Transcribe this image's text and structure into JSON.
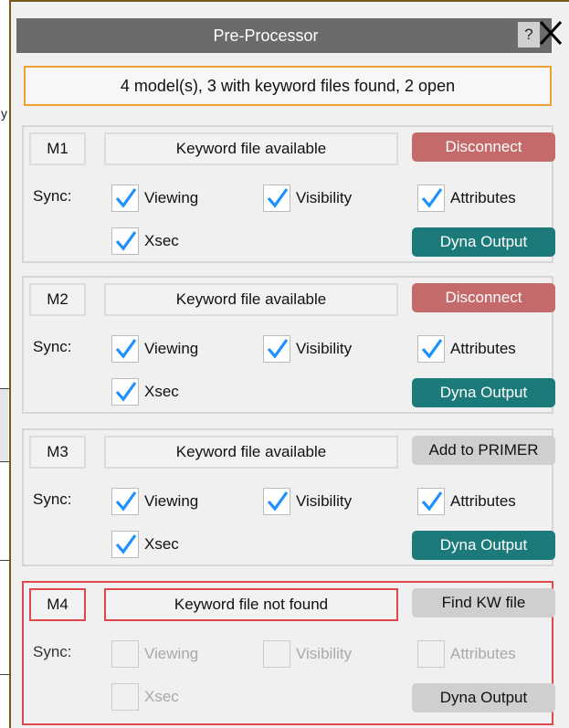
{
  "background_artifact_char": "y",
  "window": {
    "title": "Pre-Processor",
    "help_label": "?"
  },
  "summary": "4 model(s),  3 with keyword files found,  2 open",
  "sync_label": "Sync:",
  "colors": {
    "title_bar": "#6b6b6b",
    "summary_border": "#f0a030",
    "disconnect": "#c46a6a",
    "dyna_output_active": "#1c7a7a",
    "error_border": "#e0474d",
    "check": "#1e90ff"
  },
  "models": [
    {
      "id": "M1",
      "status": "Keyword file available",
      "action": "Disconnect",
      "viewing": "Viewing",
      "visibility": "Visibility",
      "attributes": "Attributes",
      "xsec": "Xsec",
      "output": "Dyna Output",
      "checked": true
    },
    {
      "id": "M2",
      "status": "Keyword file available",
      "action": "Disconnect",
      "viewing": "Viewing",
      "visibility": "Visibility",
      "attributes": "Attributes",
      "xsec": "Xsec",
      "output": "Dyna Output",
      "checked": true
    },
    {
      "id": "M3",
      "status": "Keyword file available",
      "action": "Add to PRIMER",
      "viewing": "Viewing",
      "visibility": "Visibility",
      "attributes": "Attributes",
      "xsec": "Xsec",
      "output": "Dyna Output",
      "checked": true
    },
    {
      "id": "M4",
      "status": "Keyword file not found",
      "action": "Find KW file",
      "viewing": "Viewing",
      "visibility": "Visibility",
      "attributes": "Attributes",
      "xsec": "Xsec",
      "output": "Dyna Output",
      "checked": false
    }
  ]
}
